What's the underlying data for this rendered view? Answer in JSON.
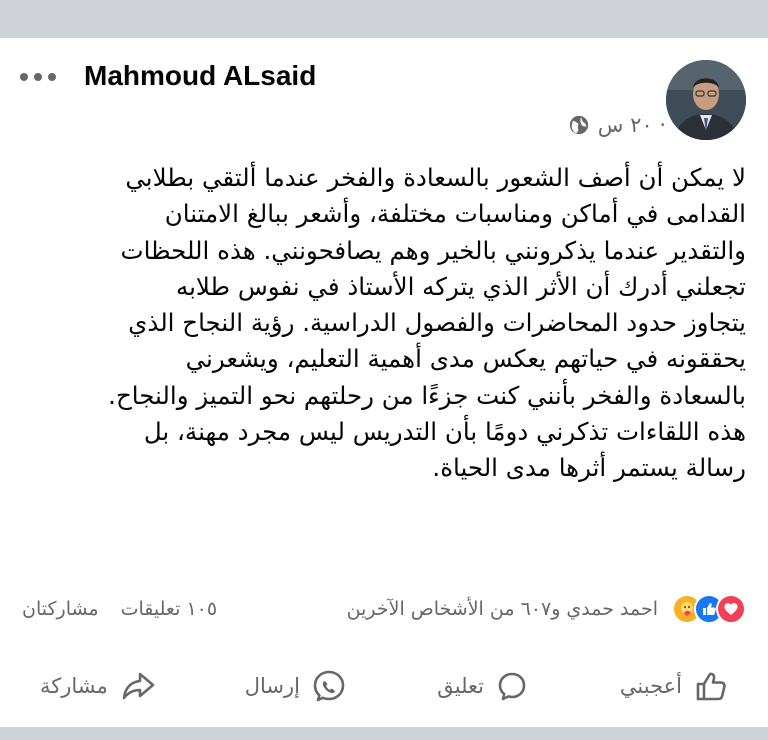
{
  "post": {
    "author": "Mahmoud ALsaid",
    "time": "٢٠ س ·",
    "privacy_icon": "globe-icon",
    "text_lines": [
      "لا يمكن أن أصف الشعور بالسعادة والفخر عندما ألتقي بطلابي",
      "القدامى في أماكن ومناسبات مختلفة، وأشعر ببالغ الامتنان",
      "والتقدير عندما يذكرونني بالخير وهم يصافحونني. هذه اللحظات",
      "تجعلني أدرك أن الأثر الذي يتركه الأستاذ في نفوس طلابه",
      "يتجاوز حدود المحاضرات والفصول الدراسية. رؤية النجاح الذي",
      "يحققونه في حياتهم يعكس مدى أهمية التعليم، ويشعرني",
      "بالسعادة والفخر بأنني كنت جزءًا من رحلتهم نحو التميز والنجاح.",
      "هذه اللقاءات تذكرني دومًا بأن التدريس ليس مجرد مهنة، بل",
      "رسالة يستمر أثرها مدى الحياة."
    ]
  },
  "reactions": {
    "icons": [
      "love-icon",
      "like-icon",
      "care-icon"
    ],
    "summary": "احمد حمدي و٦٠٧ من الأشخاص الآخرين",
    "comments": "١٠٥ تعليقات",
    "shares": "مشاركتان"
  },
  "actions": {
    "like": "أعجبني",
    "comment": "تعليق",
    "send": "إرسال",
    "share": "مشاركة"
  },
  "colors": {
    "secondary_text": "#65676b",
    "love": "#f33e58",
    "like": "#1877f2",
    "care": "#f7b125",
    "divider_band": "#cfd2d6"
  }
}
